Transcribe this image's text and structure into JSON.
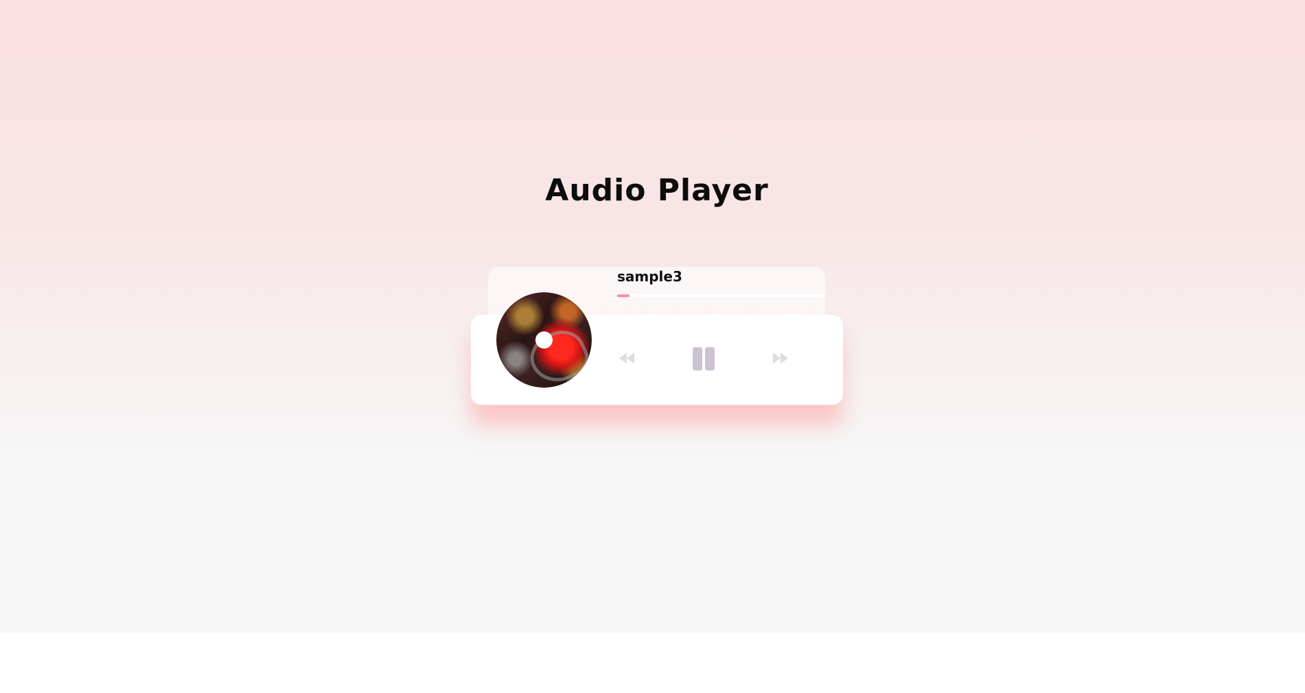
{
  "app": {
    "title": "Audio Player"
  },
  "player": {
    "track_title": "sample3",
    "progress": 0.06,
    "state": "playing",
    "album_art": "disc-album-art",
    "controls": {
      "prev_icon": "backward-icon",
      "play_pause_icon": "pause-icon",
      "next_icon": "forward-icon"
    }
  },
  "colors": {
    "background_top": "#fbdfe1",
    "background_bottom": "#f6f6f6",
    "accent": "#fe8daa",
    "control_icon": "#dfdbdf",
    "pause_icon": "#cdc2d0",
    "title_text": "#0d0d0d"
  }
}
